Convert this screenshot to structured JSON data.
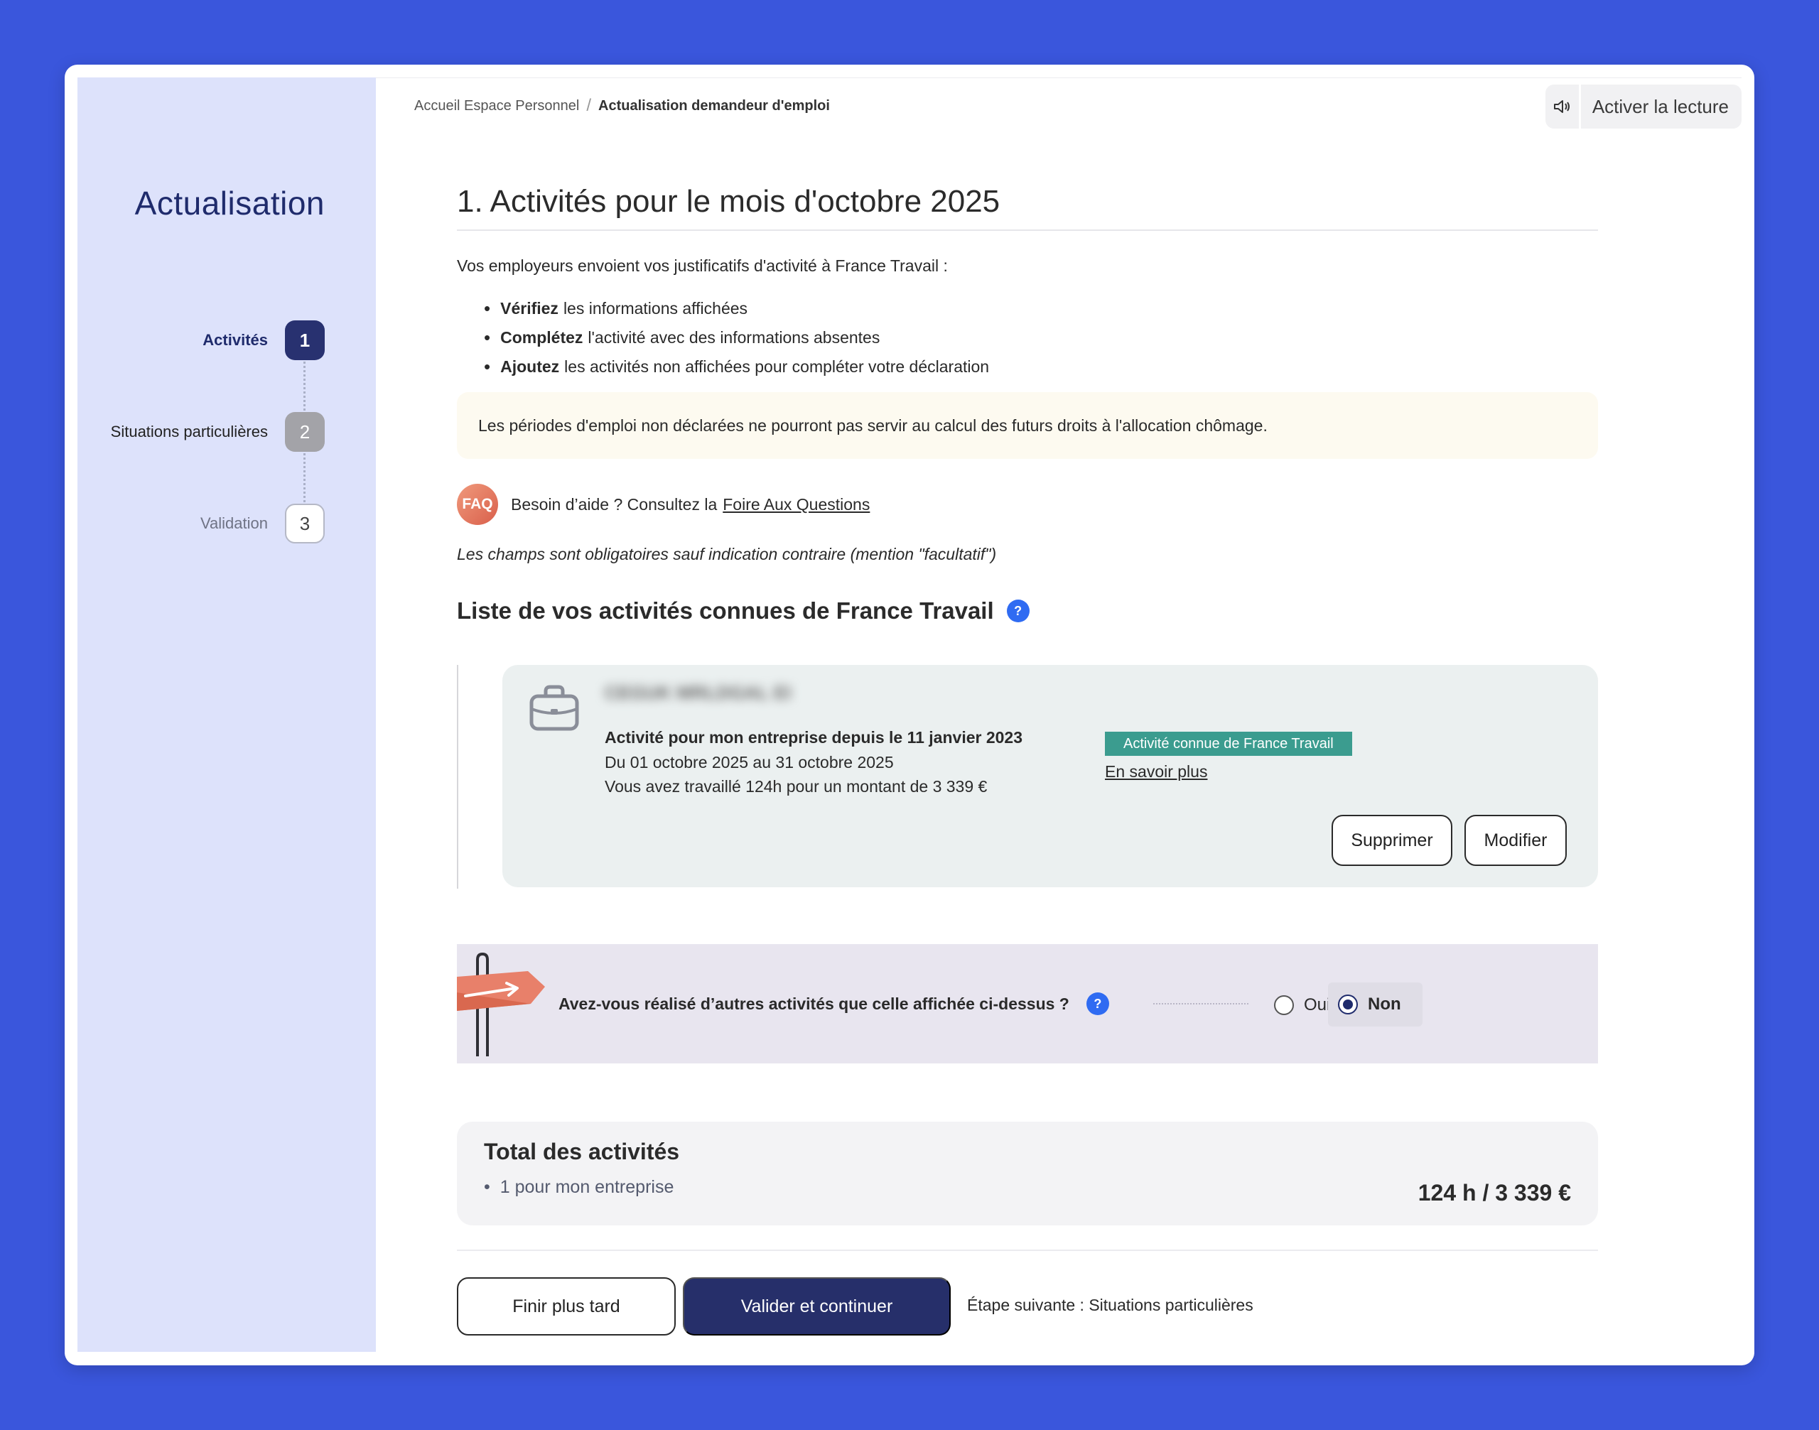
{
  "sidebar": {
    "title": "Actualisation",
    "steps": [
      {
        "label": "Activités",
        "number": "1",
        "state": "active"
      },
      {
        "label": "Situations particulières",
        "number": "2",
        "state": "pending"
      },
      {
        "label": "Validation",
        "number": "3",
        "state": "upcoming"
      }
    ]
  },
  "breadcrumb": {
    "home": "Accueil Espace Personnel",
    "separator": "/",
    "current": "Actualisation demandeur d'emploi"
  },
  "reader": {
    "label": "Activer la lecture",
    "icon": "speaker-icon"
  },
  "page": {
    "title": "1. Activités pour le mois d'octobre 2025",
    "intro": "Vos employeurs envoient vos justificatifs d'activité à France Travail :",
    "bullets": [
      {
        "bold": "Vérifiez",
        "text": "les informations affichées"
      },
      {
        "bold": "Complétez",
        "text": "l'activité avec des informations absentes"
      },
      {
        "bold": "Ajoutez",
        "text": "les activités non affichées pour compléter votre déclaration"
      }
    ],
    "notice": "Les périodes d'emploi non déclarées ne pourront pas servir au calcul des futurs droits à l'allocation chômage.",
    "faq": {
      "badge": "FAQ",
      "text": "Besoin d’aide ? Consultez la",
      "link": "Foire Aux Questions"
    },
    "mandatory": "Les champs sont obligatoires sauf indication contraire (mention \"facultatif\")",
    "section_title": "Liste de vos activités connues de France Travail",
    "help_glyph": "?"
  },
  "activity": {
    "employer": "CEGUK MRLDGAL EI",
    "title": "Activité pour mon entreprise depuis le 11 janvier 2023",
    "period": "Du 01 octobre 2025 au 31 octobre 2025",
    "amount": "Vous avez travaillé 124h pour un montant de 3 339 €",
    "badge": "Activité connue de France Travail",
    "learn_more": "En savoir plus",
    "delete_label": "Supprimer",
    "edit_label": "Modifier"
  },
  "question": {
    "text": "Avez-vous réalisé d’autres activités que celle affichée ci-dessus ?",
    "options": [
      {
        "label": "Oui",
        "selected": false
      },
      {
        "label": "Non",
        "selected": true
      }
    ]
  },
  "total": {
    "title": "Total des activités",
    "item": "1 pour mon entreprise",
    "value": "124 h / 3 339 €"
  },
  "footer": {
    "later_label": "Finir plus tard",
    "validate_label": "Valider et continuer",
    "next_step": "Étape suivante : Situations particulières"
  },
  "colors": {
    "background": "#3a56dc",
    "sidebar": "#dde2fb",
    "primary": "#262f6a",
    "badge_green": "#3b9c8f",
    "help_blue": "#2f6bf2"
  }
}
